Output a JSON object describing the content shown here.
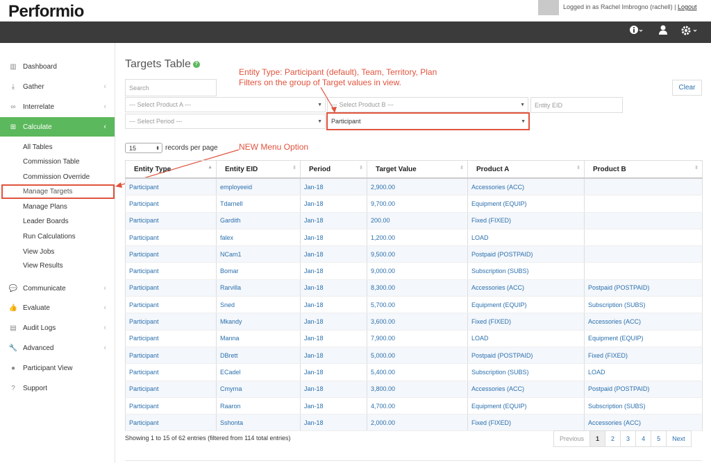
{
  "header": {
    "logo": "Performio",
    "logged_in_text": "Logged in as Rachel Imbrogno (rachell)",
    "separator": "|",
    "logout_label": "Logout"
  },
  "navbar": {
    "icons": [
      "info-icon",
      "user-icon",
      "gear-icon"
    ]
  },
  "sidebar": {
    "items": [
      {
        "label": "Dashboard",
        "icon": "bar-chart-icon"
      },
      {
        "label": "Gather",
        "icon": "download-icon"
      },
      {
        "label": "Interrelate",
        "icon": "link-icon"
      },
      {
        "label": "Calculate",
        "icon": "table-icon"
      },
      {
        "label": "Communicate",
        "icon": "comments-icon"
      },
      {
        "label": "Evaluate",
        "icon": "thumbs-up-icon"
      },
      {
        "label": "Audit Logs",
        "icon": "file-icon"
      },
      {
        "label": "Advanced",
        "icon": "wrench-icon"
      },
      {
        "label": "Participant View",
        "icon": "user-icon"
      },
      {
        "label": "Support",
        "icon": "question-icon"
      }
    ],
    "sub_items": [
      "All Tables",
      "Commission Table",
      "Commission Override",
      "Manage Targets",
      "Manage Plans",
      "Leader Boards",
      "Run Calculations",
      "View Jobs",
      "View Results"
    ]
  },
  "main": {
    "title": "Targets Table",
    "search_placeholder": "Search",
    "clear_label": "Clear",
    "product_a_select": "--- Select Product A ---",
    "product_b_select": "--- Select Product B ---",
    "entity_eid_placeholder": "Entity EID",
    "period_select": "--- Select Period ---",
    "entity_type_select": "Participant",
    "records_value": "15",
    "records_label": "records per page",
    "annotation_entity_line1": "Entity Type: Participant (default), Team, Territory, Plan",
    "annotation_entity_line2": "Filters on the group of Target values in view.",
    "annotation_menu": "NEW Menu Option",
    "table": {
      "headers": [
        "Entity Type",
        "Entity EID",
        "Period",
        "Target Value",
        "Product A",
        "Product B"
      ],
      "rows": [
        [
          "Participant",
          "employeeid",
          "Jan-18",
          "2,900.00",
          "Accessories (ACC)",
          ""
        ],
        [
          "Participant",
          "Tdarnell",
          "Jan-18",
          "9,700.00",
          "Equipment (EQUIP)",
          ""
        ],
        [
          "Participant",
          "Gardith",
          "Jan-18",
          "200.00",
          "Fixed (FIXED)",
          ""
        ],
        [
          "Participant",
          "falex",
          "Jan-18",
          "1,200.00",
          "LOAD",
          ""
        ],
        [
          "Participant",
          "NCam1",
          "Jan-18",
          "9,500.00",
          "Postpaid (POSTPAID)",
          ""
        ],
        [
          "Participant",
          "Bomar",
          "Jan-18",
          "9,000.00",
          "Subscription (SUBS)",
          ""
        ],
        [
          "Participant",
          "Rarvilla",
          "Jan-18",
          "8,300.00",
          "Accessories (ACC)",
          "Postpaid (POSTPAID)"
        ],
        [
          "Participant",
          "Sned",
          "Jan-18",
          "5,700.00",
          "Equipment (EQUIP)",
          "Subscription (SUBS)"
        ],
        [
          "Participant",
          "Mkandy",
          "Jan-18",
          "3,600.00",
          "Fixed (FIXED)",
          "Accessories (ACC)"
        ],
        [
          "Participant",
          "Manna",
          "Jan-18",
          "7,900.00",
          "LOAD",
          "Equipment (EQUIP)"
        ],
        [
          "Participant",
          "DBrett",
          "Jan-18",
          "5,000.00",
          "Postpaid (POSTPAID)",
          "Fixed (FIXED)"
        ],
        [
          "Participant",
          "ECadel",
          "Jan-18",
          "5,400.00",
          "Subscription (SUBS)",
          "LOAD"
        ],
        [
          "Participant",
          "Cmyrna",
          "Jan-18",
          "3,800.00",
          "Accessories (ACC)",
          "Postpaid (POSTPAID)"
        ],
        [
          "Participant",
          "Raaron",
          "Jan-18",
          "4,700.00",
          "Equipment (EQUIP)",
          "Subscription (SUBS)"
        ],
        [
          "Participant",
          "Sshonta",
          "Jan-18",
          "2,000.00",
          "Fixed (FIXED)",
          "Accessories (ACC)"
        ]
      ]
    },
    "info_text": "Showing 1 to 15 of 62 entries (filtered from 114 total entries)",
    "pagination": [
      "Previous",
      "1",
      "2",
      "3",
      "4",
      "5",
      "Next"
    ]
  },
  "colors": {
    "accent_green": "#5cb85c",
    "annotation_red": "#e0533d",
    "link_blue": "#2a6fad",
    "navbar": "#3b3b3b"
  }
}
